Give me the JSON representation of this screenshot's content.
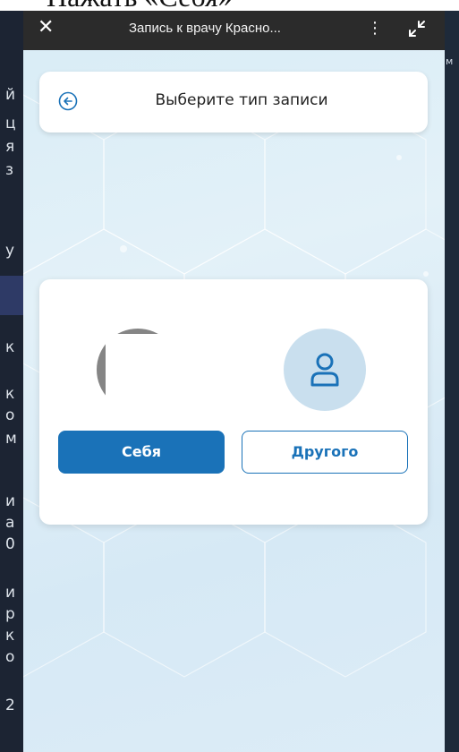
{
  "caption": {
    "text": "Нажать «Себя»"
  },
  "window": {
    "title": "Запись к врачу Красно...",
    "close_glyph": "✕",
    "menu_glyph": "⋮",
    "icons": {
      "close": "close-icon",
      "menu": "more-vertical-icon",
      "minimize": "minimize-arrows-icon"
    }
  },
  "header": {
    "title": "Выберите тип записи",
    "back_icon": "back-arrow-icon"
  },
  "choice": {
    "self_label": "Себя",
    "other_label": "Другого",
    "other_avatar_icon": "user-icon"
  },
  "colors": {
    "primary": "#1a72b8",
    "avatar_bg": "#c9dfee",
    "topbar": "#2b2b2b"
  },
  "side_fragments": {
    "left": [
      "й",
      "ц",
      "я",
      "з",
      "у",
      "к",
      "к",
      "о",
      "м",
      "и",
      "а",
      "0",
      "и",
      "р",
      "к",
      "о",
      "2"
    ],
    "right": "м"
  }
}
